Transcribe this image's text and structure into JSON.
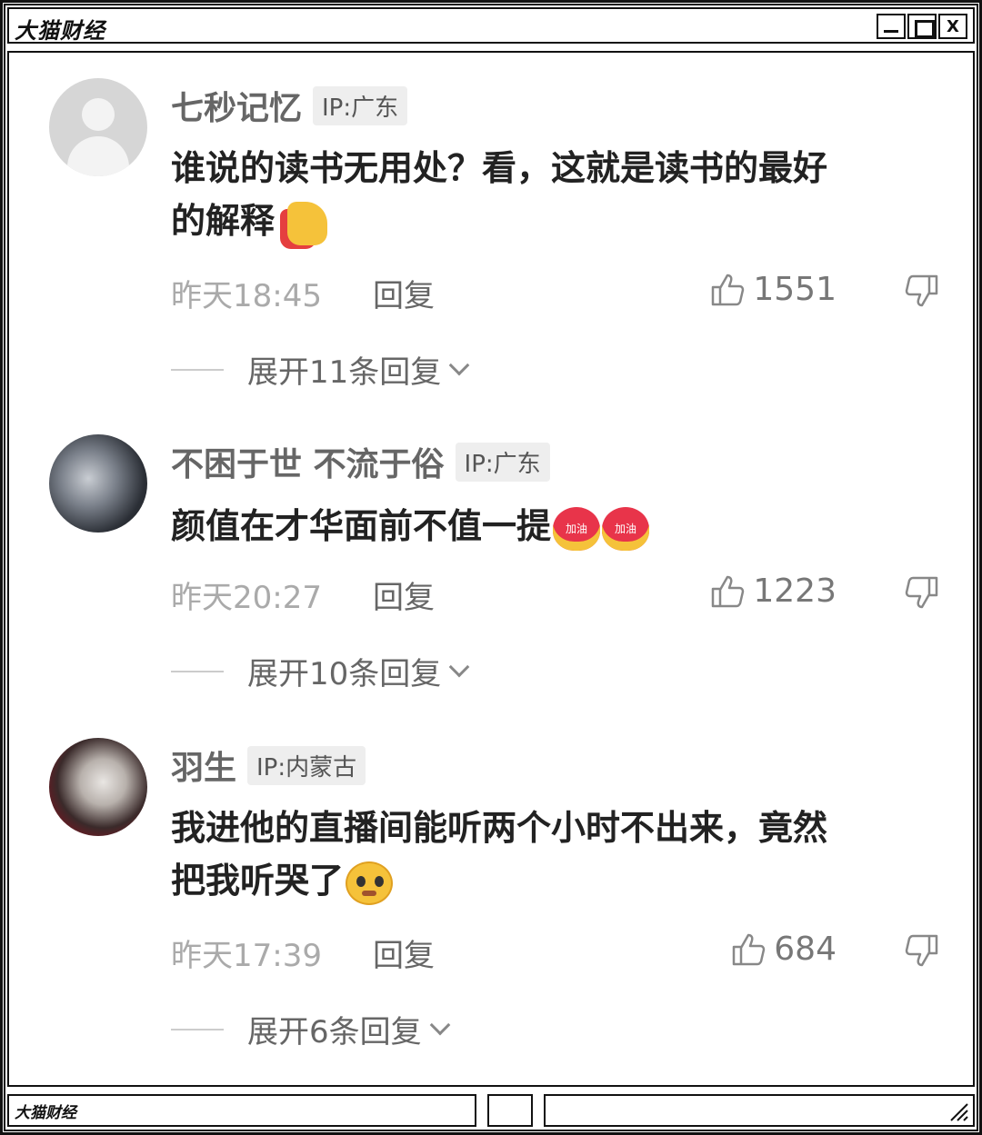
{
  "window": {
    "title": "大猫财经",
    "minimize_label": "",
    "maximize_label": "",
    "close_label": "X"
  },
  "comments": [
    {
      "username": "七秒记忆",
      "ip": "IP:广东",
      "text_line1": "谁说的读书无用处？看，这就是读书的最好",
      "text_line2": "的解释",
      "emoji": "thumbs-up",
      "time": "昨天18:45",
      "reply_label": "回复",
      "likes": "1551",
      "expand": "展开11条回复"
    },
    {
      "username": "不困于世 不流于俗",
      "ip": "IP:广东",
      "text_line1": "颜值在才华面前不值一提",
      "emoji_label": "加油",
      "time": "昨天20:27",
      "reply_label": "回复",
      "likes": "1223",
      "expand": "展开10条回复"
    },
    {
      "username": "羽生",
      "ip": "IP:内蒙古",
      "text_line1": "我进他的直播间能听两个小时不出来，竟然",
      "text_line2": "把我听哭了",
      "emoji": "pleading-face",
      "time": "昨天17:39",
      "reply_label": "回复",
      "likes": "684",
      "expand": "展开6条回复"
    }
  ],
  "footer": {
    "brand": "大猫财经"
  }
}
